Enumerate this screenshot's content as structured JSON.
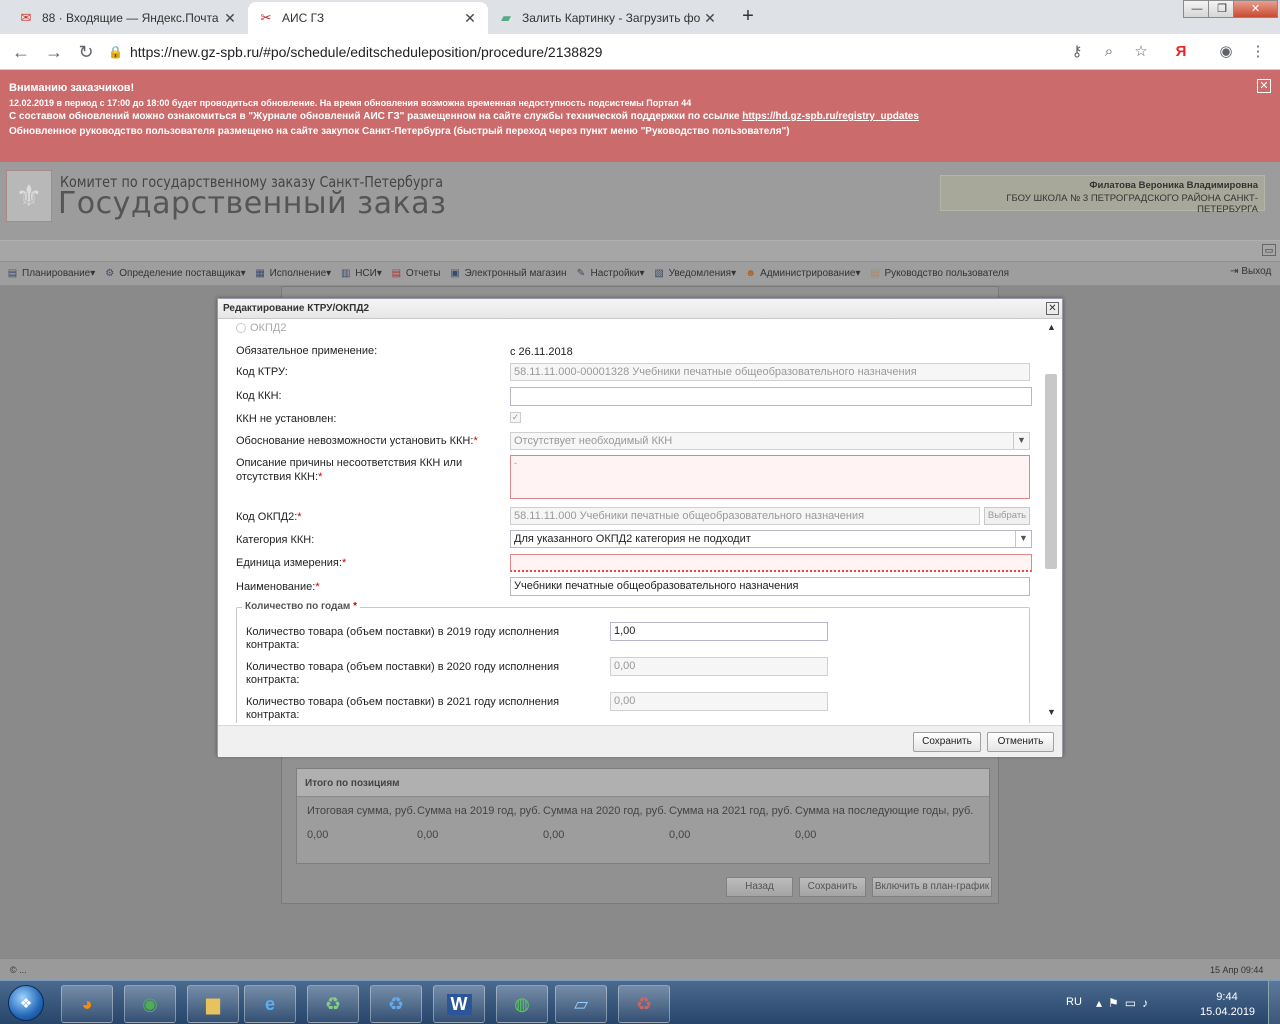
{
  "browser": {
    "tabs": [
      {
        "title": "88 · Входящие — Яндекс.Почта",
        "icon": "gmail-icon"
      },
      {
        "title": "АИС ГЗ",
        "icon": "ais-icon"
      },
      {
        "title": "Залить Картинку - Загрузить фо",
        "icon": "image-host-icon"
      }
    ],
    "url": "https://new.gz-spb.ru/#po/schedule/editscheduleposition/procedure/2138829",
    "yandex_label": "Я"
  },
  "notice": {
    "title": "Вниманию заказчиков!",
    "line2": "12.02.2019 в период с 17:00 до 18:00 будет проводиться обновление. На время обновления возможна временная недоступность подсистемы Портал 44",
    "line3_prefix": "С составом обновлений можно ознакомиться в \"Журнале обновлений АИС ГЗ\" размещенном на сайте службы технической поддержки по ссылке",
    "line3_link": "https://hd.gz-spb.ru/registry_updates",
    "line4": "Обновленное руководство пользователя размещено на сайте закупок Санкт-Петербурга (быстрый переход через пункт меню \"Руководство пользователя\")"
  },
  "header": {
    "logo_line1": "Комитет по государственному заказу Санкт-Петербурга",
    "logo_line2": "Государственный заказ",
    "user_name": "Филатова Вероника Владимировна",
    "user_org": "ГБОУ ШКОЛА № 3 ПЕТРОГРАДСКОГО РАЙОНА САНКТ-ПЕТЕРБУРГА"
  },
  "menu": {
    "items": [
      {
        "label": "Планирование",
        "icon": "planning-icon",
        "dropdown": true
      },
      {
        "label": "Определение поставщика",
        "icon": "supplier-icon",
        "dropdown": true
      },
      {
        "label": "Исполнение",
        "icon": "execution-icon",
        "dropdown": true
      },
      {
        "label": "НСИ",
        "icon": "reference-icon",
        "dropdown": true
      },
      {
        "label": "Отчеты",
        "icon": "reports-icon",
        "dropdown": false
      },
      {
        "label": "Электронный магазин",
        "icon": "shop-icon",
        "dropdown": false
      },
      {
        "label": "Настройки",
        "icon": "settings-icon",
        "dropdown": true
      },
      {
        "label": "Уведомления",
        "icon": "notifications-icon",
        "dropdown": true
      },
      {
        "label": "Администрирование",
        "icon": "admin-icon",
        "dropdown": true
      },
      {
        "label": "Руководство пользователя",
        "icon": "manual-icon",
        "dropdown": false
      }
    ],
    "exit_label": "Выход"
  },
  "modal": {
    "title": "Редактирование КТРУ/ОКПД2",
    "radio_okpd2": "ОКПД2",
    "fields": {
      "mandatory_label": "Обязательное применение:",
      "mandatory_value": "с 26.11.2018",
      "ktru_label": "Код КТРУ:",
      "ktru_value": "58.11.11.000-00001328 Учебники печатные общеобразовательного назначения",
      "kkn_label": "Код ККН:",
      "kkn_value": "",
      "kkn_not_set_label": "ККН не установлен:",
      "reason_label": "Обоснование невозможности установить ККН:",
      "reason_value": "Отсутствует необходимый ККН",
      "desc_label_1": "Описание причины несоответствия ККН или",
      "desc_label_2": "отсутствия ККН:",
      "desc_value": "-",
      "okpd2_label": "Код ОКПД2:",
      "okpd2_value": "58.11.11.000 Учебники печатные общеобразовательного назначения",
      "okpd2_select": "Выбрать",
      "category_label": "Категория ККН:",
      "category_value": "Для указанного ОКПД2 категория не подходит",
      "unit_label": "Единица измерения:",
      "unit_value": "",
      "name_label": "Наименование:",
      "name_value": "Учебники печатные общеобразовательного назначения"
    },
    "years_group": {
      "title": "Количество по годам",
      "rows": [
        {
          "label_1": "Количество товара (объем поставки) в 2019 году исполнения",
          "label_2": "контракта:",
          "value": "1,00"
        },
        {
          "label_1": "Количество товара (объем поставки) в 2020 году исполнения",
          "label_2": "контракта:",
          "value": "0,00"
        },
        {
          "label_1": "Количество товара (объем поставки) в 2021 году исполнения",
          "label_2": "контракта:",
          "value": "0,00"
        }
      ]
    },
    "save": "Сохранить",
    "cancel": "Отменить"
  },
  "totals": {
    "title": "Итого по позициям",
    "columns": [
      "Итоговая сумма, руб.",
      "Сумма на 2019 год, руб.",
      "Сумма на 2020 год, руб.",
      "Сумма на 2021 год, руб.",
      "Сумма на последующие годы, руб."
    ],
    "values": [
      "0,00",
      "0,00",
      "0,00",
      "0,00",
      "0,00"
    ]
  },
  "footer_buttons": {
    "back": "Назад",
    "save": "Сохранить",
    "include": "Включить в план-график"
  },
  "status": {
    "left": "© ...",
    "right": "15 Апр 09:44"
  },
  "taskbar": {
    "lang": "RU",
    "time": "9:44",
    "date": "15.04.2019",
    "apps": [
      "firefox-icon",
      "chrome-icon",
      "explorer-icon",
      "ie-icon",
      "recycle-app-icon",
      "recycle-app-icon",
      "word-icon",
      "cash-icon",
      "notepad-icon",
      "recycle-app-icon"
    ]
  }
}
